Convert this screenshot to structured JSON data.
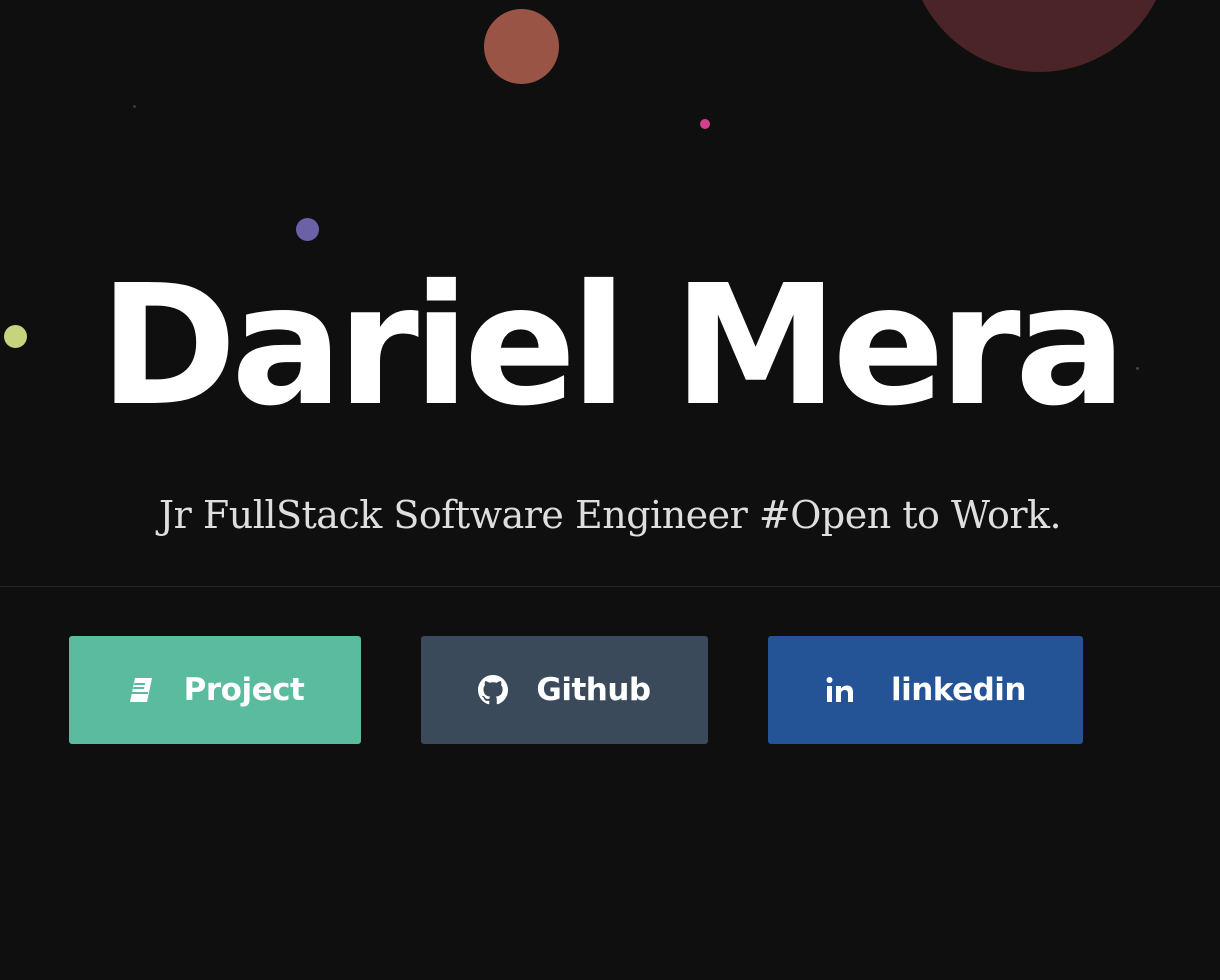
{
  "hero": {
    "name": "Dariel Mera",
    "tagline": "Jr FullStack Software Engineer #Open to Work."
  },
  "buttons": [
    {
      "label": "Project",
      "icon": "book-icon",
      "color": "#5abb9f"
    },
    {
      "label": "Github",
      "icon": "github-icon",
      "color": "#3a4a5b"
    },
    {
      "label": "linkedin",
      "icon": "linkedin-icon",
      "color": "#245496"
    }
  ],
  "theme": {
    "background": "#0f0f10",
    "text": "#ffffff"
  }
}
